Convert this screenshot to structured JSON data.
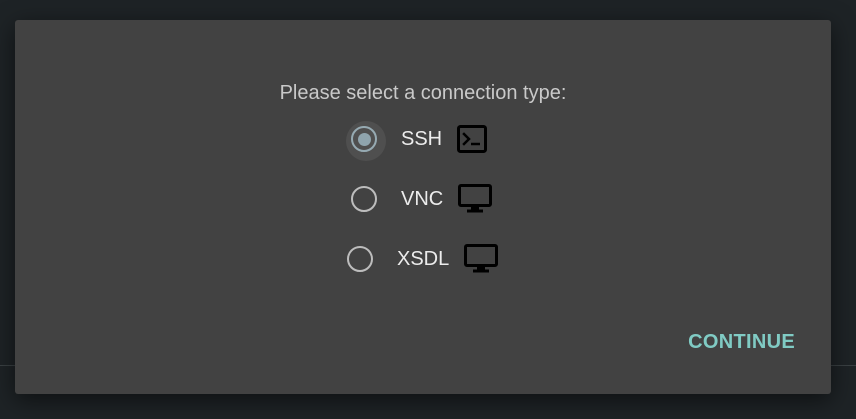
{
  "dialog": {
    "prompt": "Please select a connection type:",
    "options": [
      {
        "label": "SSH",
        "icon": "terminal-icon",
        "selected": true
      },
      {
        "label": "VNC",
        "icon": "monitor-icon",
        "selected": false
      },
      {
        "label": "XSDL",
        "icon": "monitor-icon",
        "selected": false
      }
    ],
    "continue_label": "CONTINUE"
  },
  "colors": {
    "dialog_bg": "#424242",
    "backdrop": "#1e2326",
    "accent": "#80cbc4",
    "radio_selected": "#8fa4ad"
  }
}
